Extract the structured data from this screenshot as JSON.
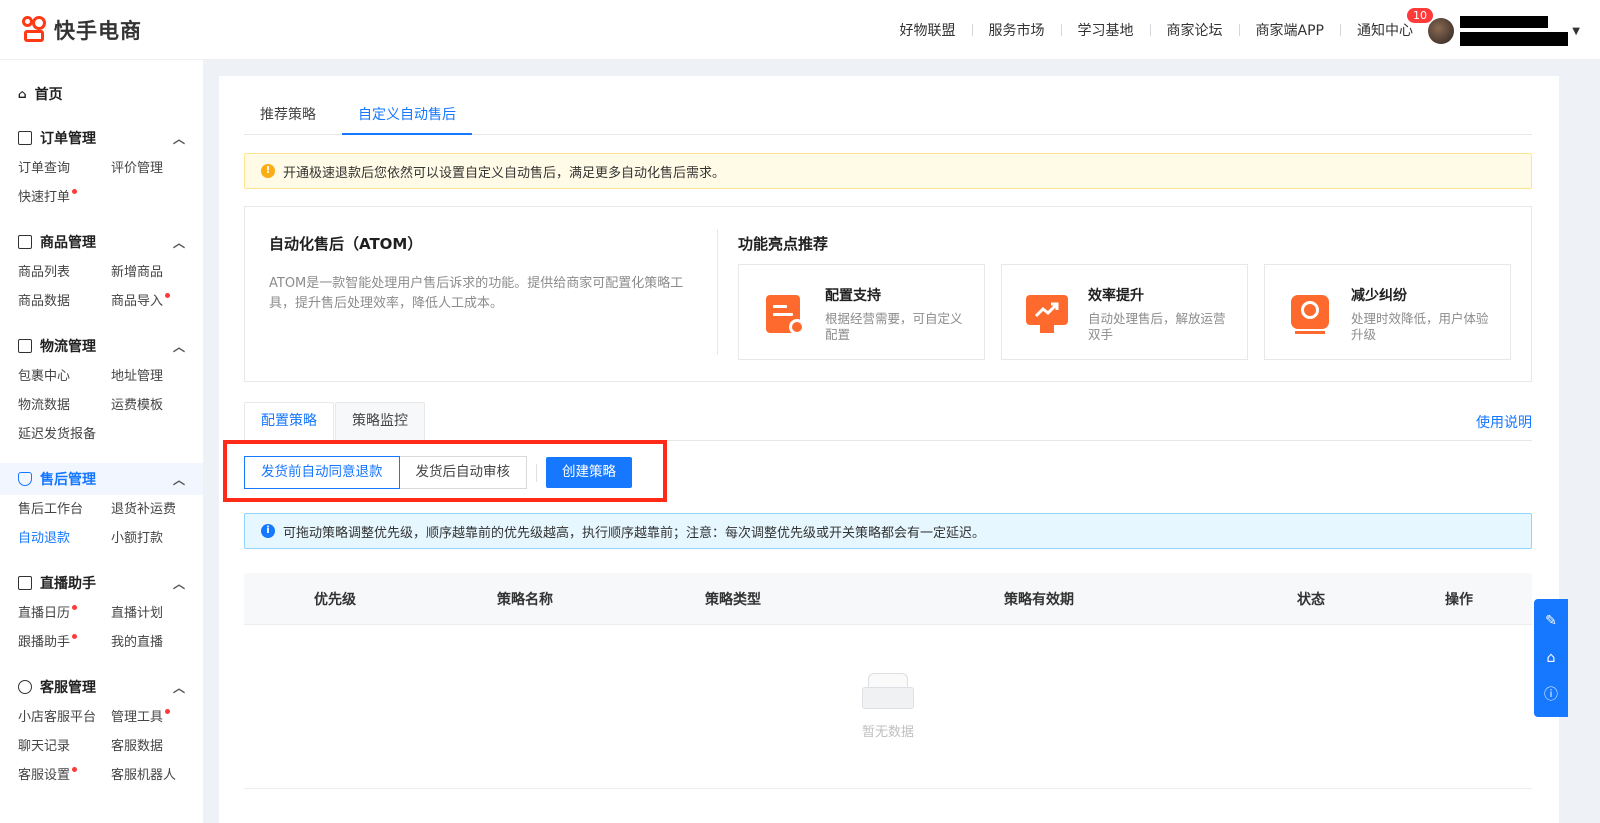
{
  "header": {
    "logo_text": "快手电商",
    "nav": [
      "好物联盟",
      "服务市场",
      "学习基地",
      "商家论坛",
      "商家端APP",
      "通知中心"
    ],
    "notification_count": "10"
  },
  "sidebar": {
    "home": "首页",
    "groups": [
      {
        "title": "订单管理",
        "items": [
          "订单查询",
          "评价管理",
          "快速打单"
        ]
      },
      {
        "title": "商品管理",
        "items": [
          "商品列表",
          "新增商品",
          "商品数据",
          "商品导入"
        ]
      },
      {
        "title": "物流管理",
        "items": [
          "包裹中心",
          "地址管理",
          "物流数据",
          "运费模板",
          "延迟发货报备"
        ]
      },
      {
        "title": "售后管理",
        "items": [
          "售后工作台",
          "退货补运费",
          "自动退款",
          "小额打款"
        ]
      },
      {
        "title": "直播助手",
        "items": [
          "直播日历",
          "直播计划",
          "跟播助手",
          "我的直播"
        ]
      },
      {
        "title": "客服管理",
        "items": [
          "小店客服平台",
          "管理工具",
          "聊天记录",
          "客服数据",
          "客服设置",
          "客服机器人"
        ]
      }
    ]
  },
  "main": {
    "tabs": [
      "推荐策略",
      "自定义自动售后"
    ],
    "notice": "开通极速退款后您依然可以设置自定义自动售后，满足更多自动化售后需求。",
    "atom": {
      "title": "自动化售后（ATOM）",
      "desc": "ATOM是一款智能处理用户售后诉求的功能。提供给商家可配置化策略工具，提升售后处理效率，降低人工成本。"
    },
    "features": {
      "title": "功能亮点推荐",
      "items": [
        {
          "title": "配置支持",
          "desc": "根据经营需要，可自定义配置"
        },
        {
          "title": "效率提升",
          "desc": "自动处理售后，解放运营双手"
        },
        {
          "title": "减少纠纷",
          "desc": "处理时效降低，用户体验升级"
        }
      ]
    },
    "card_tabs": [
      "配置策略",
      "策略监控"
    ],
    "help_link": "使用说明",
    "segments": [
      "发货前自动同意退款",
      "发货后自动审核"
    ],
    "create_button": "创建策略",
    "info": "可拖动策略调整优先级，顺序越靠前的优先级越高，执行顺序越靠前；注意：每次调整优先级或开关策略都会有一定延迟。",
    "table": {
      "columns": [
        "优先级",
        "策略名称",
        "策略类型",
        "策略有效期",
        "状态",
        "操作"
      ],
      "empty_text": "暂无数据"
    }
  }
}
